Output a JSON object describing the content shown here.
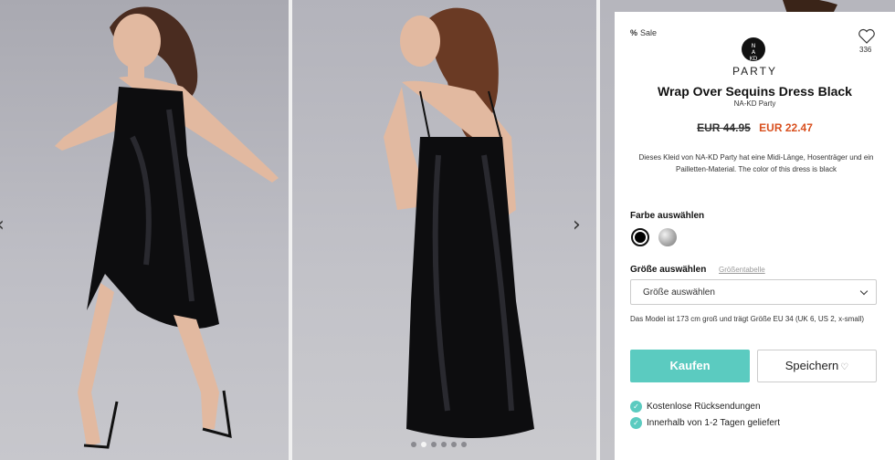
{
  "gallery": {
    "prev_arrow": "‹",
    "next_arrow": "›",
    "dot_count": 6
  },
  "product": {
    "sale_label": "Sale",
    "sale_icon": "%",
    "wishlist_count": "336",
    "logo_text": "NA-KD",
    "brand": "PARTY",
    "title": "Wrap Over Sequins Dress Black",
    "subtitle": "NA-KD Party",
    "old_price": "EUR  44.95",
    "new_price": "EUR  22.47",
    "description": "Dieses Kleid von NA-KD Party hat eine Midi-Länge, Hosenträger und ein Pailletten-Material. The color of this dress is black",
    "color_label": "Farbe auswählen",
    "colors": [
      "black",
      "silver"
    ],
    "size_label": "Größe auswählen",
    "size_chart_link": "Größentabelle",
    "size_select_value": "Größe auswählen",
    "model_note": "Das Model ist 173 cm groß und trägt Größe EU 34 (UK 6, US 2, x-small)",
    "buy_button": "Kaufen",
    "save_button": "Speichern",
    "perks": [
      "Kostenlose Rücksendungen",
      "Innerhalb von 1-2 Tagen geliefert"
    ]
  },
  "colors": {
    "accent": "#5bcbc0",
    "sale_price": "#d9501f"
  }
}
